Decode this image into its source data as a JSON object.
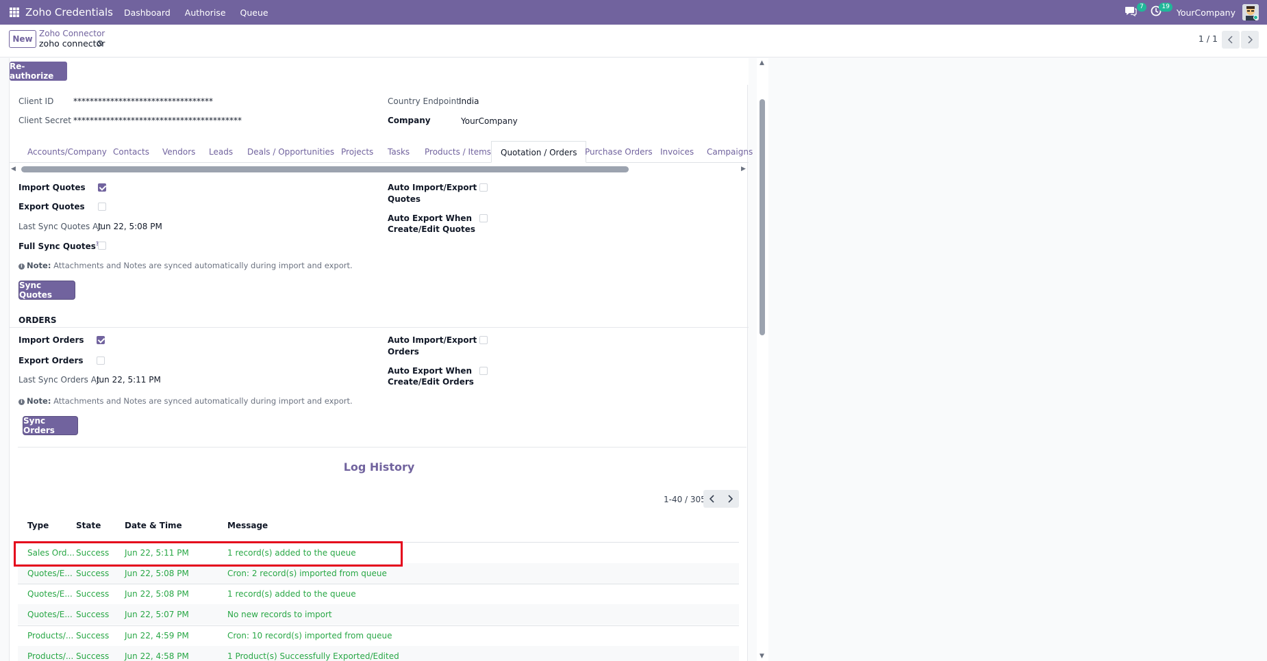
{
  "navbar": {
    "app_title": "Zoho Credentials",
    "menu": [
      "Dashboard",
      "Authorise",
      "Queue"
    ],
    "messages_count": "7",
    "activities_count": "19",
    "company": "YourCompany"
  },
  "control": {
    "new_label": "New",
    "breadcrumb_parent": "Zoho Connector",
    "breadcrumb_current": "zoho connector",
    "pager": "1 / 1"
  },
  "form": {
    "reauthorize_label": "Re-authorize",
    "client_id_label": "Client ID",
    "client_id_value": "**********************************",
    "client_secret_label": "Client Secret",
    "client_secret_value": "*****************************************",
    "country_endpoint_label": "Country Endpoint",
    "country_endpoint_value": "India",
    "company_label": "Company",
    "company_value": "YourCompany"
  },
  "tabs": [
    "Accounts/Company",
    "Contacts",
    "Vendors",
    "Leads",
    "Deals / Opportunities",
    "Projects",
    "Tasks",
    "Products / Items",
    "Quotation / Orders",
    "Purchase Orders",
    "Invoices",
    "Campaigns"
  ],
  "active_tab": "Quotation / Orders",
  "quotes": {
    "import_label": "Import Quotes",
    "import_checked": true,
    "export_label": "Export Quotes",
    "export_checked": false,
    "last_sync_label": "Last Sync Quotes At",
    "last_sync_value": "Jun 22, 5:08 PM",
    "full_sync_label": "Full Sync Quotes",
    "full_sync_help": "?",
    "full_sync_checked": false,
    "auto_import_label_1": "Auto Import/Export",
    "auto_import_label_2": "Quotes",
    "auto_export_label_1": "Auto Export When",
    "auto_export_label_2": "Create/Edit Quotes",
    "note_label": "Note:",
    "note_text": "Attachments and Notes are synced automatically during import and export.",
    "sync_button": "Sync Quotes"
  },
  "orders": {
    "section_title": "ORDERS",
    "import_label": "Import Orders",
    "import_checked": true,
    "export_label": "Export Orders",
    "export_checked": false,
    "last_sync_label": "Last Sync Orders At",
    "last_sync_value": "Jun 22, 5:11 PM",
    "auto_import_label_1": "Auto Import/Export",
    "auto_import_label_2": "Orders",
    "auto_export_label_1": "Auto Export When",
    "auto_export_label_2": "Create/Edit Orders",
    "note_label": "Note:",
    "note_text": "Attachments and Notes are synced automatically during import and export.",
    "sync_button": "Sync Orders"
  },
  "log": {
    "title": "Log History",
    "pager": "1-40 / 305",
    "columns": [
      "Type",
      "State",
      "Date & Time",
      "Message"
    ],
    "rows": [
      {
        "type": "Sales Ord...",
        "state": "Success",
        "datetime": "Jun 22, 5:11 PM",
        "message": "1 record(s) added to the queue"
      },
      {
        "type": "Quotes/E...",
        "state": "Success",
        "datetime": "Jun 22, 5:08 PM",
        "message": "Cron: 2 record(s) imported from queue"
      },
      {
        "type": "Quotes/E...",
        "state": "Success",
        "datetime": "Jun 22, 5:08 PM",
        "message": "1 record(s) added to the queue"
      },
      {
        "type": "Quotes/E...",
        "state": "Success",
        "datetime": "Jun 22, 5:07 PM",
        "message": "No new records to import"
      },
      {
        "type": "Products/...",
        "state": "Success",
        "datetime": "Jun 22, 4:59 PM",
        "message": "Cron: 10 record(s) imported from queue"
      },
      {
        "type": "Products/...",
        "state": "Success",
        "datetime": "Jun 22, 4:58 PM",
        "message": "1 Product(s) Successfully Exported/Edited"
      }
    ]
  },
  "colors": {
    "brand": "#71639e",
    "success": "#28a745",
    "highlight": "#e4001b"
  }
}
